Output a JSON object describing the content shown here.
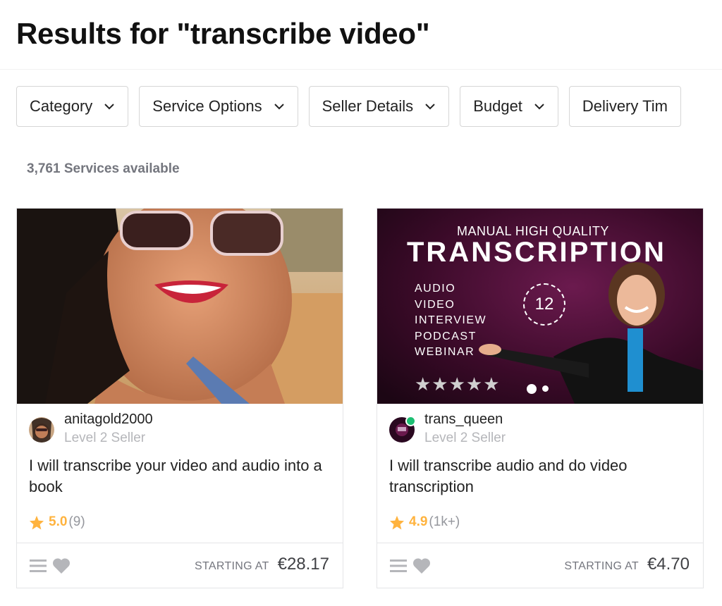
{
  "page": {
    "title": "Results for \"transcribe video\"",
    "services_count": "3,761 Services available"
  },
  "filters": [
    {
      "label": "Category"
    },
    {
      "label": "Service Options"
    },
    {
      "label": "Seller Details"
    },
    {
      "label": "Budget"
    },
    {
      "label": "Delivery Tim"
    }
  ],
  "gigs": [
    {
      "seller": "anitagold2000",
      "level": "Level 2 Seller",
      "title": "I will transcribe your video and audio into a book",
      "rating": "5.0",
      "reviews": "(9)",
      "starting_label": "STARTING AT",
      "price": "€28.17",
      "online": false
    },
    {
      "seller": "trans_queen",
      "level": "Level 2 Seller",
      "title": "I will transcribe audio and do video transcription",
      "rating": "4.9",
      "reviews": "(1k+)",
      "starting_label": "STARTING AT",
      "price": "€4.70",
      "online": true,
      "thumbnail": {
        "subtitle": "MANUAL HIGH QUALITY",
        "headline": "TRANSCRIPTION",
        "list": [
          "AUDIO",
          "VIDEO",
          "INTERVIEW",
          "PODCAST",
          "WEBINAR"
        ],
        "clock_number": "12",
        "stars": "★★★★★"
      }
    }
  ],
  "colors": {
    "star": "#ffb33e",
    "online": "#1dbf73",
    "muted": "#74767e",
    "thumb_bg": "#3a0a28"
  },
  "icons": [
    "chevron-down-icon",
    "star-icon",
    "menu-icon",
    "heart-icon",
    "clock-icon"
  ]
}
